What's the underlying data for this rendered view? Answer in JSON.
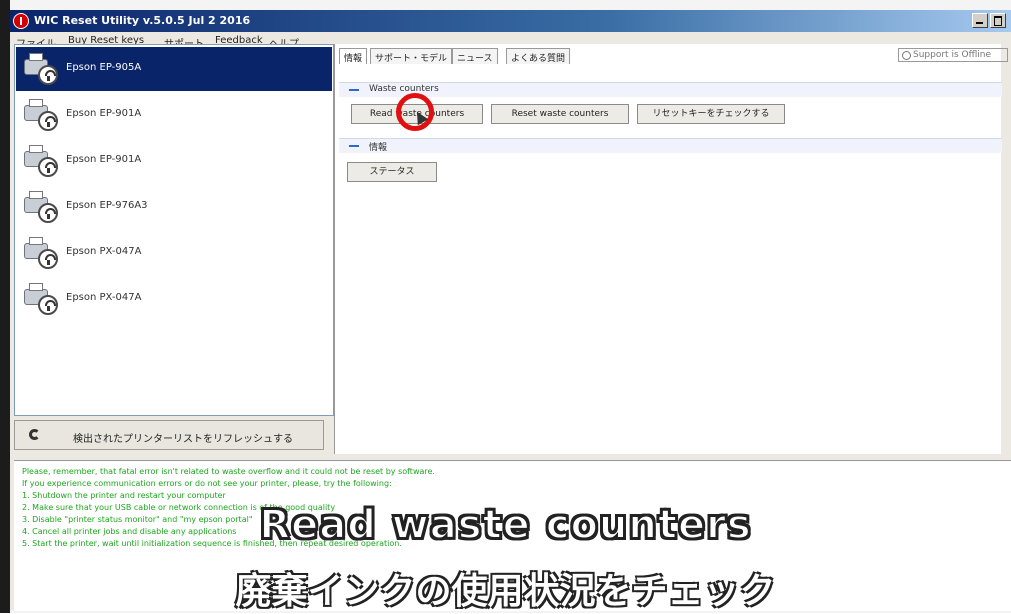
{
  "window": {
    "title": "WIC Reset Utility v.5.0.5 Jul 2 2016"
  },
  "menu": [
    "ファイル",
    "Buy Reset keys",
    "サポート",
    "Feedback",
    "ヘルプ"
  ],
  "printers": [
    "Epson EP-905A",
    "Epson EP-901A",
    "Epson EP-901A",
    "Epson EP-976A3",
    "Epson PX-047A",
    "Epson PX-047A"
  ],
  "refresh_label": "検出されたプリンターリストをリフレッシュする",
  "tabs": [
    "情報",
    "サポート・モデル",
    "ニュース",
    "よくある質問"
  ],
  "support_status": "Support is Offline",
  "waste": {
    "title": "Waste counters",
    "read_label": "Read waste counters",
    "reset_label": "Reset waste counters",
    "check_label": "リセットキーをチェックする"
  },
  "info": {
    "title": "情報",
    "status_label": "ステータス"
  },
  "log": [
    "Please, remember, that fatal error isn't related to waste overflow and it could not be reset by software.",
    "If you experience communication errors or do not see your printer, please, try the following:",
    "1. Shutdown the printer and restart your computer",
    "2. Make sure that your USB cable or network connection is of the good quality",
    "3. Disable \"printer status monitor\" and \"my epson portal\"",
    "4. Cancel all printer jobs and disable any applications",
    "5. Start the printer, wait until initialization sequence is finished, then repeat desired operation."
  ],
  "captions": {
    "en": "Read waste counters",
    "jp": "廃棄インクの使用状況をチェック"
  },
  "colors": {
    "selection": "#0a246a",
    "highlight_ring": "#e01010",
    "log_text": "#1fa51f"
  }
}
